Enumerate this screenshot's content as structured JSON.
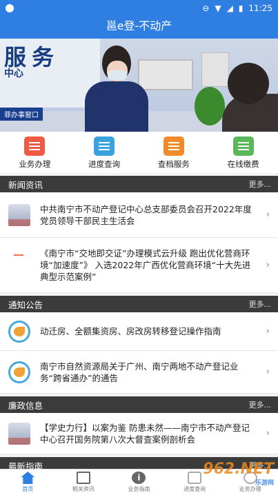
{
  "status_bar": {
    "time": "11:25"
  },
  "header": {
    "title": "邕e登-不动产"
  },
  "banner": {
    "sign_big": "服务",
    "sign_small": "中心",
    "tag": "菲办事窗口"
  },
  "quick_menu": [
    {
      "label": "业务办理",
      "icon": "edit-doc-icon",
      "color": "#ee5a43"
    },
    {
      "label": "进度查询",
      "icon": "search-doc-icon",
      "color": "#3aa2dc"
    },
    {
      "label": "查档服务",
      "icon": "archive-icon",
      "color": "#f08a2a"
    },
    {
      "label": "在线缴费",
      "icon": "wallet-icon",
      "color": "#5bb85a"
    }
  ],
  "sections": {
    "news": {
      "title": "新闻资讯",
      "more": "更多...",
      "items": [
        "中共南宁市不动产登记中心总支部委员会召开2022年度党员领导干部民主生活会",
        "《南宁市“交地即交证”办理模式云升级 跑出优化营商环境“加速度”》 入选2022年广西优化营商环境“十大先进典型示范案例”"
      ]
    },
    "notice": {
      "title": "通知公告",
      "more": "更多...",
      "items": [
        "动迁房、全额集资房、房改房转移登记操作指南",
        "南宁市自然资源局关于广州、南宁两地不动产登记业务“跨省通办”的通告"
      ]
    },
    "integrity": {
      "title": "廉政信息",
      "more": "更多...",
      "items": [
        "【学史力行】以案为鉴 防患未然——南宁市不动产登记中心召开国务院第八次大督查案例剖析会"
      ]
    },
    "guide": {
      "title": "最新指南",
      "more": "更多..."
    }
  },
  "tabbar": [
    {
      "label": "首页"
    },
    {
      "label": "相关资讯"
    },
    {
      "label": "业务指南"
    },
    {
      "label": "进度查询"
    },
    {
      "label": "业务办理"
    }
  ],
  "watermark": {
    "brand": "962.NET",
    "sub": "乐游网"
  },
  "colors": {
    "primary": "#2f7fe3",
    "section_header": "#3b3b3b"
  }
}
